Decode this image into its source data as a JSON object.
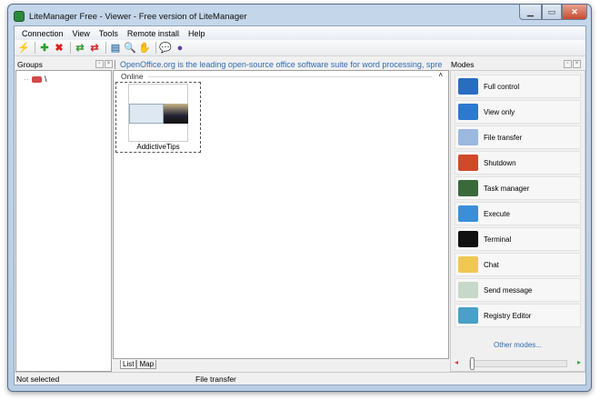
{
  "window": {
    "title": "LiteManager Free - Viewer - Free version of LiteManager",
    "controls": [
      "minimize",
      "maximize",
      "close"
    ]
  },
  "menu": [
    "Connection",
    "View",
    "Tools",
    "Remote install",
    "Help"
  ],
  "toolbar": [
    {
      "icon": "connect-icon",
      "glyph": "⚡",
      "color": "#e0b020"
    },
    {
      "icon": "add-icon",
      "glyph": "✚",
      "color": "#2ca02c"
    },
    {
      "icon": "delete-icon",
      "glyph": "✖",
      "color": "#d62020"
    },
    {
      "icon": "sync-green-icon",
      "glyph": "⇄",
      "color": "#3a9a3a"
    },
    {
      "icon": "sync-red-icon",
      "glyph": "⇄",
      "color": "#d03030"
    },
    {
      "icon": "view-icon",
      "glyph": "▤",
      "color": "#5080b0"
    },
    {
      "icon": "search-icon",
      "glyph": "🔍",
      "color": "#333"
    },
    {
      "icon": "hand-icon",
      "glyph": "✋",
      "color": "#d09020"
    },
    {
      "icon": "chat-icon",
      "glyph": "💬",
      "color": "#e0b020"
    },
    {
      "icon": "user-icon",
      "glyph": "●",
      "color": "#6040a0"
    }
  ],
  "groups": {
    "title": "Groups",
    "root": "\\"
  },
  "center": {
    "banner": "OpenOffice.org is the leading open-source office software suite for word processing, spre",
    "section": "Online",
    "computer": "AddictiveTips",
    "tabs": [
      "List",
      "Map"
    ]
  },
  "modes": {
    "title": "Modes",
    "items": [
      {
        "label": "Full control",
        "icon": "full-control-icon",
        "color": "#2a6cc0"
      },
      {
        "label": "View only",
        "icon": "view-only-icon",
        "color": "#2f78d0"
      },
      {
        "label": "File transfer",
        "icon": "file-transfer-icon",
        "color": "#9bb8df"
      },
      {
        "label": "Shutdown",
        "icon": "shutdown-icon",
        "color": "#d04a2a"
      },
      {
        "label": "Task manager",
        "icon": "task-manager-icon",
        "color": "#3a6a3a"
      },
      {
        "label": "Execute",
        "icon": "execute-icon",
        "color": "#3b8fd8"
      },
      {
        "label": "Terminal",
        "icon": "terminal-icon",
        "color": "#111111"
      },
      {
        "label": "Chat",
        "icon": "chat-icon",
        "color": "#f0c850"
      },
      {
        "label": "Send message",
        "icon": "send-message-icon",
        "color": "#c8d8c8"
      },
      {
        "label": "Registry Editor",
        "icon": "registry-editor-icon",
        "color": "#4aa0c8"
      }
    ],
    "other": "Other modes...",
    "zoom_slider": 0
  },
  "status": {
    "left": "Not selected",
    "mode": "File transfer"
  }
}
